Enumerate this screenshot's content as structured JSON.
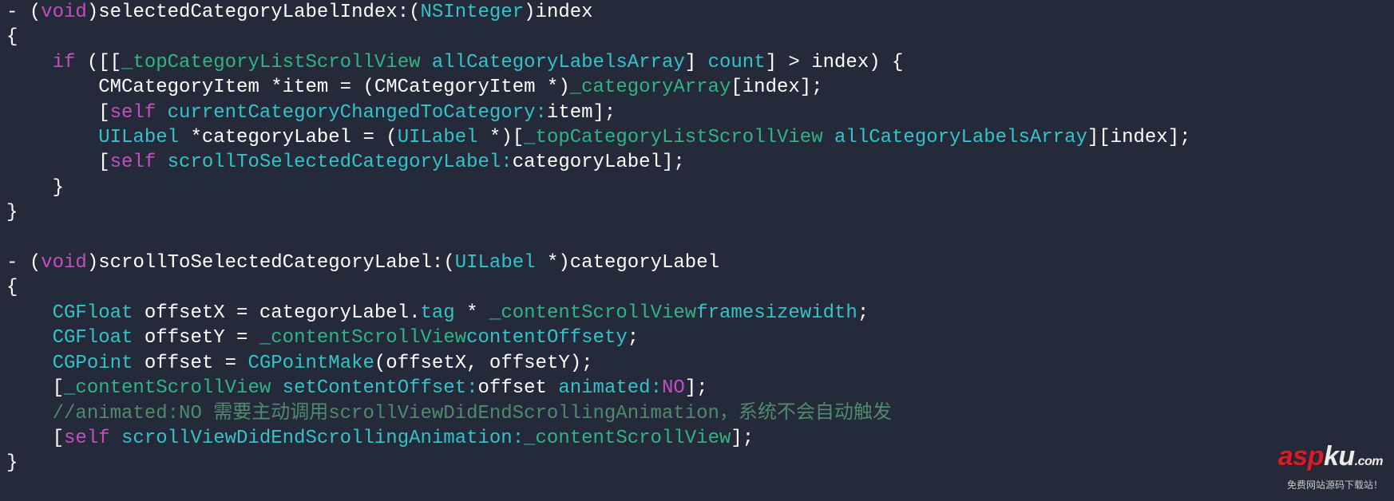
{
  "code": {
    "l1": {
      "dash": "- ",
      "lp": "(",
      "void": "void",
      "rp": ")",
      "m": "selectedCategoryLabelIndex:",
      "lp2": "(",
      "t": "NSInteger",
      "rp2": ")",
      "p": "index"
    },
    "l2": "{",
    "l3": {
      "indent": "    ",
      "if": "if",
      "open": " ([[",
      "ivar": "_topCategoryListScrollView",
      "sp": " ",
      "sel": "allCategoryLabelsArray",
      "mid": "] ",
      "sel2": "count",
      "tail": "] > index) {"
    },
    "l4": {
      "indent": "        ",
      "txt": "CMCategoryItem *item = (CMCategoryItem *)",
      "ivar": "_categoryArray",
      "tail": "[index];"
    },
    "l5": {
      "indent": "        [",
      "self": "self",
      "sp": " ",
      "sel": "currentCategoryChangedToCategory:",
      "arg": "item];"
    },
    "l6": {
      "indent": "        ",
      "t1": "UILabel",
      "mid": " *categoryLabel = (",
      "t2": "UILabel",
      "mid2": " *)[",
      "ivar": "_topCategoryListScrollView",
      "sp": " ",
      "sel": "allCategoryLabelsArray",
      "tail": "][index];"
    },
    "l7": {
      "indent": "        [",
      "self": "self",
      "sp": " ",
      "sel": "scrollToSelectedCategoryLabel:",
      "arg": "categoryLabel];"
    },
    "l8": "    }",
    "l9": "}",
    "l10": "",
    "l11": {
      "dash": "- ",
      "lp": "(",
      "void": "void",
      "rp": ")",
      "m": "scrollToSelectedCategoryLabel:",
      "lp2": "(",
      "t": "UILabel",
      "star": " *",
      "rp2": ")",
      "p": "categoryLabel"
    },
    "l12": "{",
    "l13": {
      "indent": "    ",
      "t": "CGFloat",
      "mid": " offsetX = categoryLabel.",
      "p1": "tag",
      "mid2": " * ",
      "ivar": "_contentScrollView",
      ".": ".",
      "p2": "frame",
      ".2": ".",
      "p3": "size",
      ".3": ".",
      "p4": "width",
      "semi": ";"
    },
    "l14": {
      "indent": "    ",
      "t": "CGFloat",
      "mid": " offsetY = ",
      "ivar": "_contentScrollView",
      ".": ".",
      "p1": "contentOffset",
      ".2": ".",
      "p2": "y",
      "semi": ";"
    },
    "l15": {
      "indent": "    ",
      "t": "CGPoint",
      "mid": " offset = ",
      "fn": "CGPointMake",
      "args": "(offsetX, offsetY);"
    },
    "l16": {
      "indent": "    [",
      "ivar": "_contentScrollView",
      "sp": " ",
      "sel": "setContentOffset:",
      "arg1": "offset ",
      "sel2": "animated:",
      "lit": "NO",
      "tail": "];"
    },
    "l17": {
      "indent": "    ",
      "c": "//animated:NO 需要主动调用scrollViewDidEndScrollingAnimation，系统不会自动触发"
    },
    "l18": {
      "indent": "    [",
      "self": "self",
      "sp": " ",
      "sel": "scrollViewDidEndScrollingAnimation:",
      "ivar": "_contentScrollView",
      "tail": "];"
    },
    "l19": "}"
  },
  "watermark": {
    "brand_red": "asp",
    "brand_wht": "ku",
    "dotcom": ".com",
    "tagline": "免费网站源码下载站！"
  }
}
